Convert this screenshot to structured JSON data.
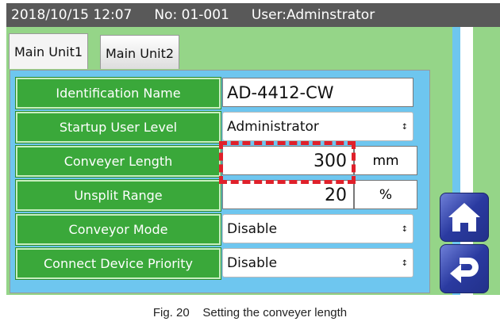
{
  "topbar": {
    "datetime": "2018/10/15 12:07",
    "number": "No: 01-001",
    "user": "User:Adminstrator"
  },
  "tabs": [
    {
      "label": "Main Unit1",
      "active": true
    },
    {
      "label": "Main Unit2",
      "active": false
    }
  ],
  "rows": [
    {
      "label": "Identification Name",
      "value": "AD-4412-CW"
    },
    {
      "label": "Startup User Level",
      "value": "Administrator"
    },
    {
      "label": "Conveyer Length",
      "value": "300",
      "unit": "mm"
    },
    {
      "label": "Unsplit Range",
      "value": "20",
      "unit": "%"
    },
    {
      "label": "Conveyor Mode",
      "value": "Disable"
    },
    {
      "label": "Connect Device Priority",
      "value": "Disable"
    }
  ],
  "colors": {
    "label_bg": "#3aa83a",
    "panel": "#6ec6ef",
    "screen": "#95d588",
    "highlight": "#e0202a"
  },
  "caption": "Fig. 20    Setting the conveyer length"
}
